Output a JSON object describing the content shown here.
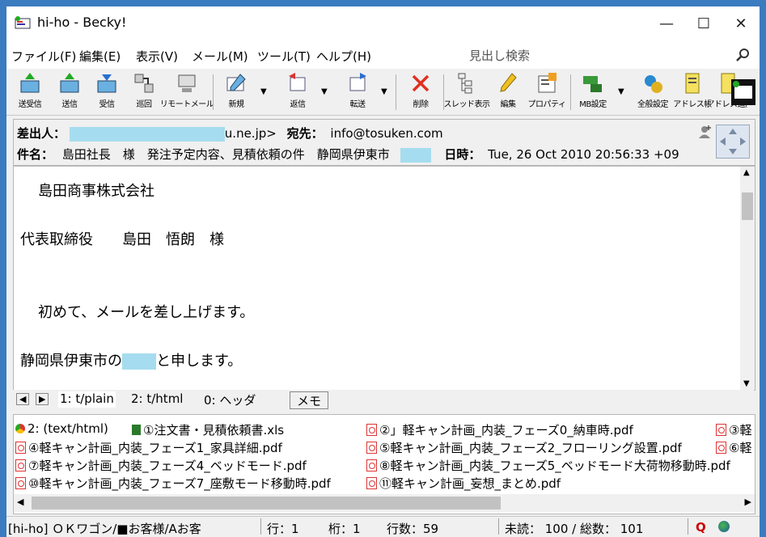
{
  "window": {
    "title": "hi-ho - Becky!",
    "minimize": "—",
    "maximize": "☐",
    "close": "✕"
  },
  "menu": [
    "ファイル(F)",
    "編集(E)",
    "表示(V)",
    "メール(M)",
    "ツール(T)",
    "ヘルプ(H)"
  ],
  "search": {
    "placeholder": "見出し検索"
  },
  "toolbar": [
    {
      "label": "送受信",
      "icon": "send-receive-icon"
    },
    {
      "label": "送信",
      "icon": "send-icon"
    },
    {
      "label": "受信",
      "icon": "receive-icon"
    },
    {
      "label": "巡回",
      "icon": "patrol-icon"
    },
    {
      "label": "リモートメール",
      "icon": "remote-mail-icon"
    },
    {
      "label": "新規",
      "icon": "new-mail-icon"
    },
    {
      "label": "返信",
      "icon": "reply-icon"
    },
    {
      "label": "転送",
      "icon": "forward-icon"
    },
    {
      "label": "削除",
      "icon": "delete-icon"
    },
    {
      "label": "スレッド表示",
      "icon": "thread-icon"
    },
    {
      "label": "編集",
      "icon": "edit-icon"
    },
    {
      "label": "プロパティ",
      "icon": "properties-icon"
    },
    {
      "label": "MB設定",
      "icon": "mailbox-settings-icon"
    },
    {
      "label": "全般設定",
      "icon": "general-settings-icon"
    },
    {
      "label": "アドレス帳",
      "icon": "address-book-icon"
    },
    {
      "label": "アドレス追加",
      "icon": "address-add-icon"
    }
  ],
  "header": {
    "from_label": "差出人：",
    "from_suffix": "u.ne.jp>",
    "to_label": "宛先：",
    "to_value": "info@tosuken.com",
    "subject_label": "件名：",
    "subject_value": "島田社長　様　発注予定内容、見積依頼の件　静岡県伊東市",
    "date_label": "日時：",
    "date_value": "Tue, 26 Oct 2010 20:56:33 +09"
  },
  "body": {
    "line1": "島田商事株式会社",
    "line2": "代表取締役　　島田　悟朗　様",
    "line3": "初めて、メールを差し上げます。",
    "line4_a": "静岡県伊東市の",
    "line4_b": "と申します。"
  },
  "tabs": [
    "1: t/plain",
    "2: t/html",
    "0: ヘッダ",
    "メモ"
  ],
  "attachments": [
    "2: (text/html)",
    "①注文書・見積依頼書.xls",
    "②」軽キャン計画_内装_フェーズ0_納車時.pdf",
    "③軽",
    "④軽キャン計画_内装_フェーズ1_家具詳細.pdf",
    "⑤軽キャン計画_内装_フェーズ2_フローリング設置.pdf",
    "⑥軽",
    "⑦軽キャン計画_内装_フェーズ4_ベッドモード.pdf",
    "⑧軽キャン計画_内装_フェーズ5_ベッドモード大荷物移動時.pdf",
    "⑩軽キャン計画_内装_フェーズ7_座敷モード移動時.pdf",
    "⑪軽キャン計画_妄想_まとめ.pdf"
  ],
  "status": {
    "folder": "[hi-ho] ＯＫワゴン/■お客様/Aお客",
    "row": "行：1",
    "col": "桁：1",
    "lines": "行数：59",
    "counts": "未読：  100 / 総数：  101"
  },
  "colors": {
    "accent": "#3b7bbf",
    "redaction": "#a6dcef"
  }
}
